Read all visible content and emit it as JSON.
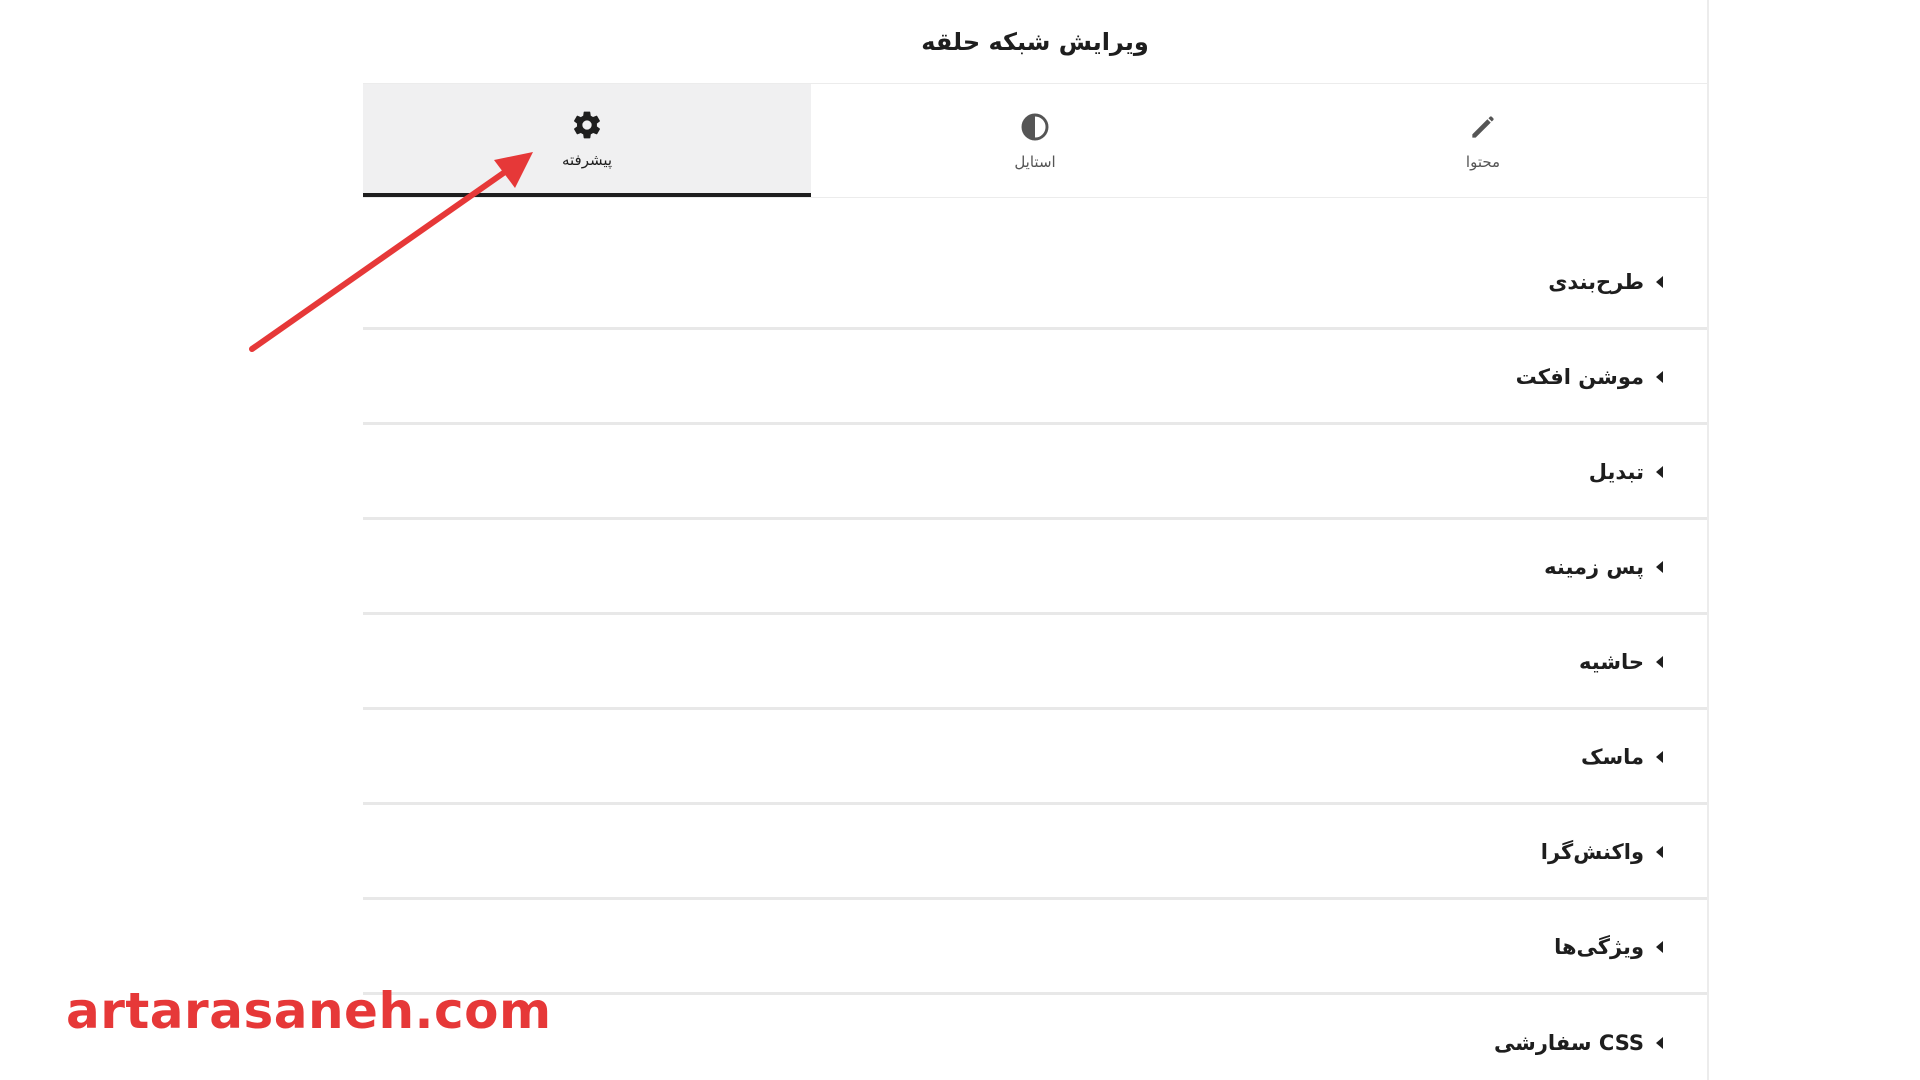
{
  "panel": {
    "title": "ویرایش شبکه حلقه"
  },
  "tabs": [
    {
      "label": "محتوا",
      "icon": "pencil-icon",
      "active": false
    },
    {
      "label": "استایل",
      "icon": "contrast-icon",
      "active": false
    },
    {
      "label": "پیشرفته",
      "icon": "gear-icon",
      "active": true
    }
  ],
  "sections": [
    {
      "label": "طرح‌بندی"
    },
    {
      "label": "موشن افکت"
    },
    {
      "label": "تبدیل"
    },
    {
      "label": "پس زمینه"
    },
    {
      "label": "حاشیه"
    },
    {
      "label": "ماسک"
    },
    {
      "label": "واکنش‌گرا"
    },
    {
      "label": "ویژگی‌ها"
    },
    {
      "label": "CSS سفارشی"
    }
  ],
  "watermark": {
    "text": "artarasaneh.com"
  },
  "colors": {
    "accent": "#1e1e1e",
    "annotation_arrow": "#e63838",
    "active_tab_bg": "#f0f0f1"
  }
}
